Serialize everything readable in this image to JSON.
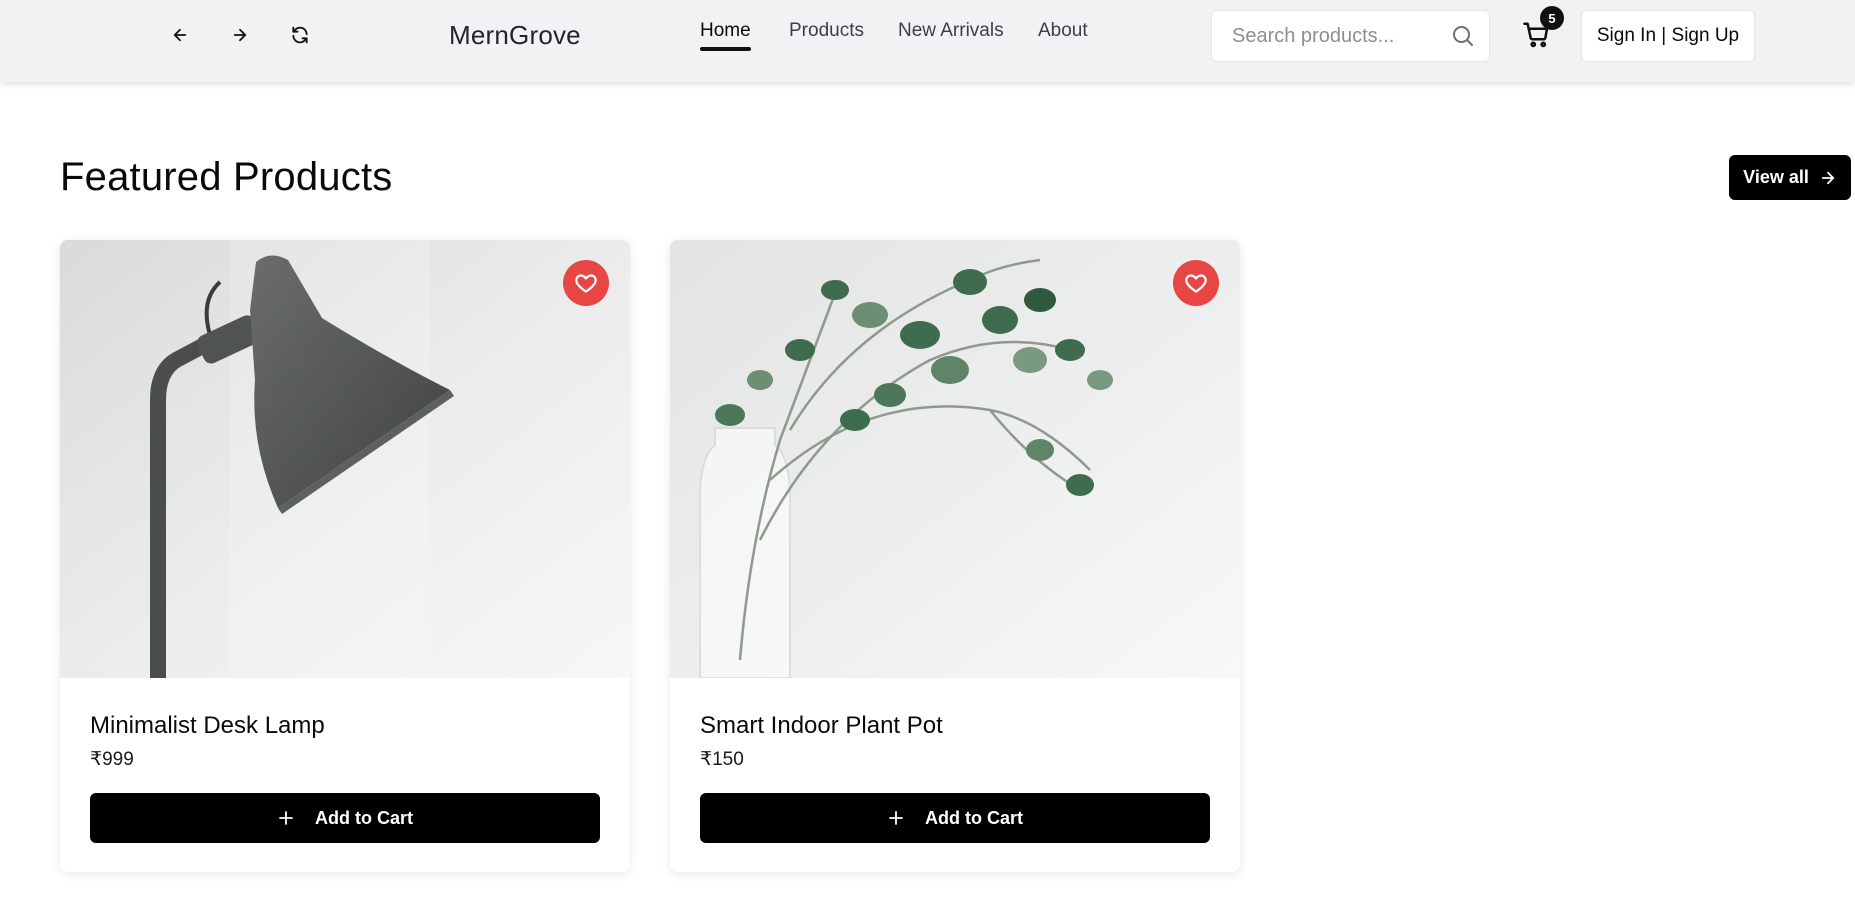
{
  "header": {
    "brand": "MernGrove",
    "nav": {
      "back_icon": "arrow-left-icon",
      "forward_icon": "arrow-right-icon",
      "reload_icon": "refresh-icon"
    },
    "menu": [
      {
        "label": "Home",
        "active": true
      },
      {
        "label": "Products",
        "active": false
      },
      {
        "label": "New Arrivals",
        "active": false
      },
      {
        "label": "About",
        "active": false
      }
    ],
    "search": {
      "placeholder": "Search products...",
      "value": "",
      "icon": "search-icon"
    },
    "cart": {
      "icon": "cart-icon",
      "count": "5"
    },
    "signin_label": "Sign In | Sign Up"
  },
  "featured": {
    "title": "Featured Products",
    "view_all_label": "View all",
    "view_all_icon": "arrow-right-icon"
  },
  "products": [
    {
      "name": "Minimalist Desk Lamp",
      "price": "₹999",
      "add_label": "Add to Cart",
      "image": "desk-lamp",
      "favorite_icon": "heart-icon"
    },
    {
      "name": "Smart Indoor Plant Pot",
      "price": "₹150",
      "add_label": "Add to Cart",
      "image": "eucalyptus-vase",
      "favorite_icon": "heart-icon"
    }
  ],
  "colors": {
    "header_bg": "#f1f2f4",
    "primary": "#000000",
    "favorite": "#e84545"
  }
}
